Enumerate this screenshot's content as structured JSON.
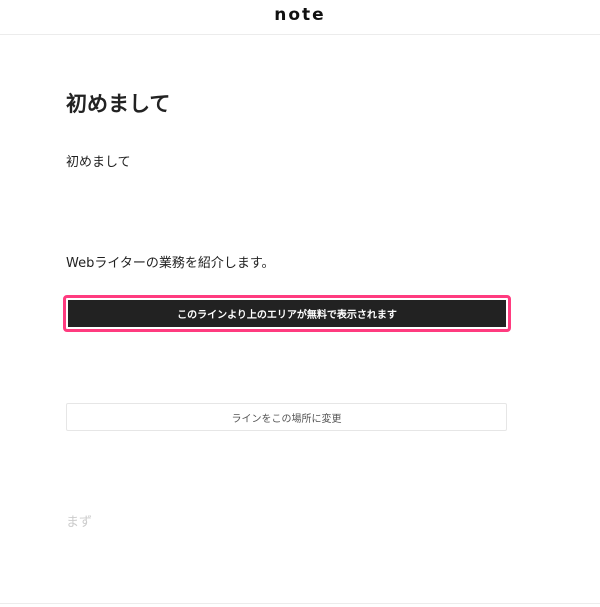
{
  "header": {
    "logo": "note"
  },
  "article": {
    "title": "初めまして",
    "paragraphs": [
      "初めまして",
      "Webライターの業務を紹介します。"
    ],
    "paywall_line_label": "このラインより上のエリアが無料で表示されます",
    "move_line_button": "ラインをこの場所に変更",
    "next_line_text": "まず"
  },
  "colors": {
    "highlight": "#ff3b7f",
    "paywall_bar": "#222222"
  }
}
